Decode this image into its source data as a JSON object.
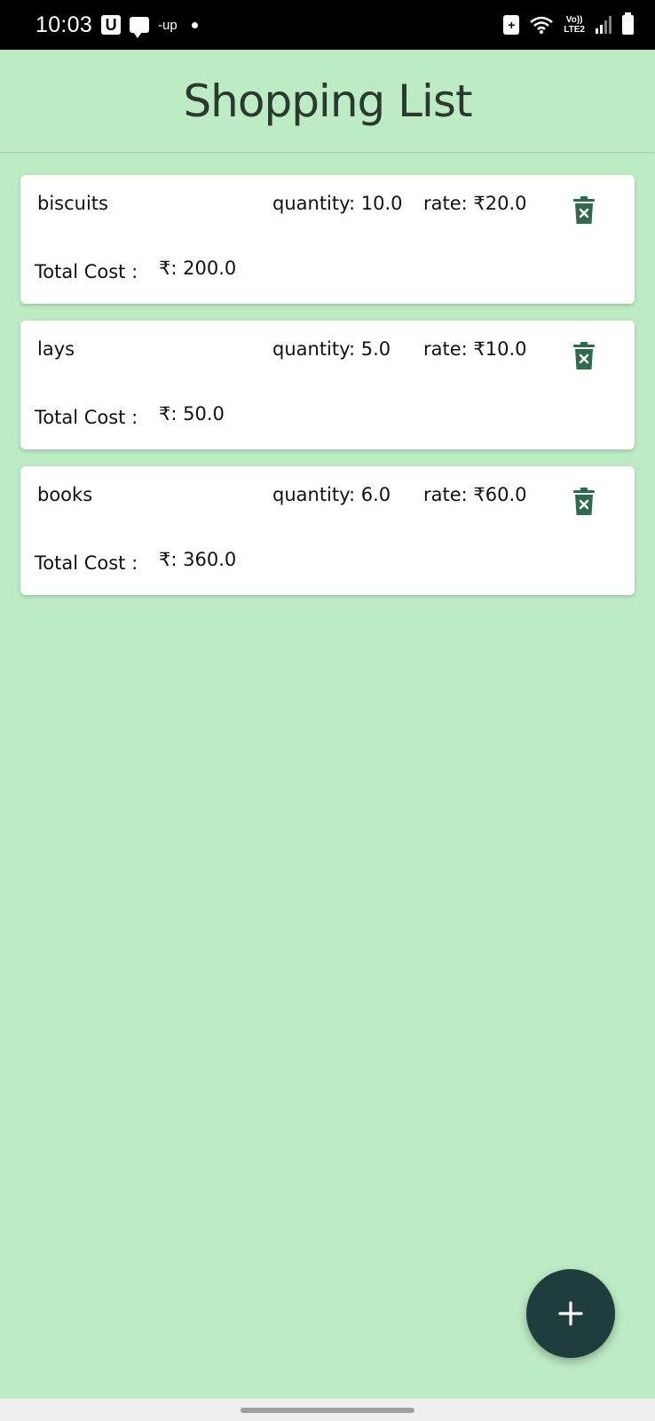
{
  "status_bar": {
    "time": "10:03",
    "notif_u": "U",
    "notif_up": "-up",
    "network_line1": "Vo))",
    "network_line2": "LTE2"
  },
  "header": {
    "title": "Shopping List"
  },
  "items": [
    {
      "name": "biscuits",
      "quantity": "quantity: 10.0",
      "rate": "rate: ₹20.0",
      "total_label": "Total Cost :",
      "total_value": "₹: 200.0"
    },
    {
      "name": "lays",
      "quantity": "quantity: 5.0",
      "rate": "rate: ₹10.0",
      "total_label": "Total Cost :",
      "total_value": "₹: 50.0"
    },
    {
      "name": "books",
      "quantity": "quantity: 6.0",
      "rate": "rate: ₹60.0",
      "total_label": "Total Cost :",
      "total_value": "₹: 360.0"
    }
  ],
  "fab": {
    "icon": "plus-icon"
  },
  "colors": {
    "background": "#bdebc4",
    "accent": "#1f3d3c",
    "delete_icon": "#2e6b4c"
  }
}
